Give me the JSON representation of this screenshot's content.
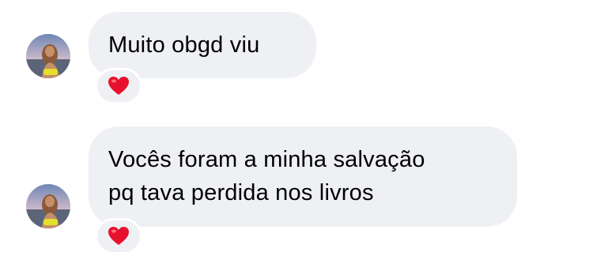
{
  "messages": [
    {
      "text_lines": [
        "Muito obgd viu"
      ],
      "reaction_icon": "heart-icon",
      "reaction_color": "#e8112d"
    },
    {
      "text_lines": [
        "Vocês foram a minha salvação",
        "pq tava perdida nos livros"
      ],
      "reaction_icon": "heart-icon",
      "reaction_color": "#e8112d"
    }
  ],
  "colors": {
    "bubble_bg": "#eef0f4",
    "text": "#000000",
    "background": "#ffffff"
  }
}
